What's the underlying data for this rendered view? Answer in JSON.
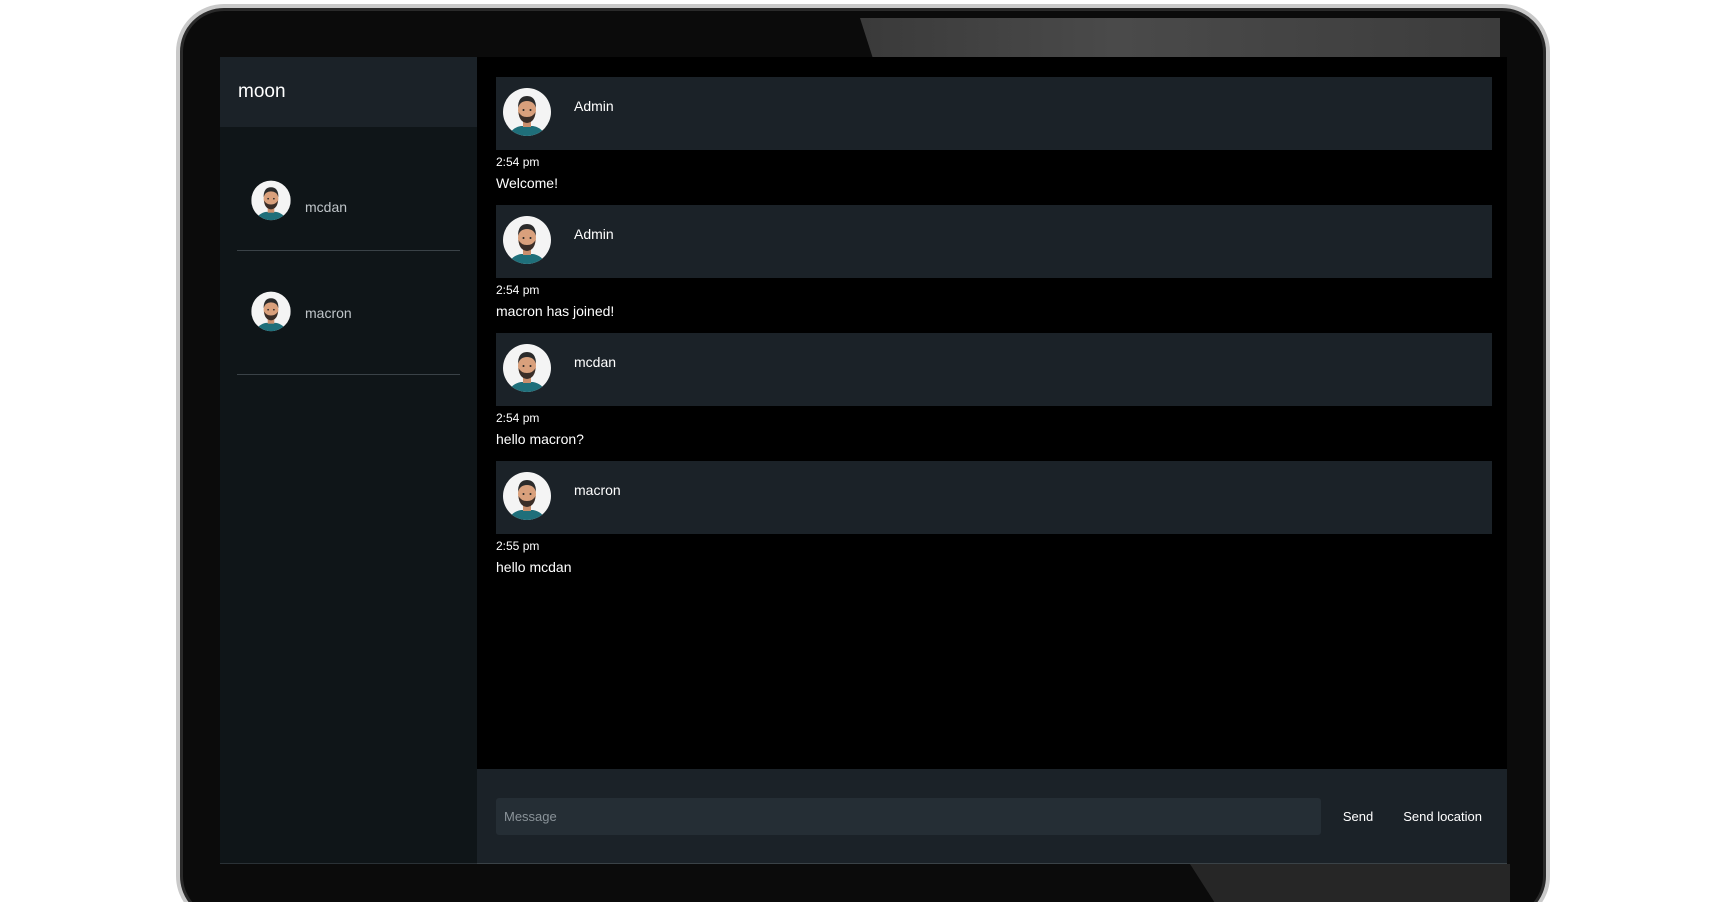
{
  "room": {
    "name": "moon"
  },
  "users": [
    {
      "name": "mcdan"
    },
    {
      "name": "macron"
    }
  ],
  "messages": [
    {
      "author": "Admin",
      "time": "2:54 pm",
      "text": "Welcome!"
    },
    {
      "author": "Admin",
      "time": "2:54 pm",
      "text": "macron has joined!"
    },
    {
      "author": "mcdan",
      "time": "2:54 pm",
      "text": "hello macron?"
    },
    {
      "author": "macron",
      "time": "2:55 pm",
      "text": "hello mcdan"
    }
  ],
  "composer": {
    "placeholder": "Message",
    "send_label": "Send",
    "location_label": "Send location"
  },
  "colors": {
    "sidebar_bg": "#0f1518",
    "panel_bg": "#1b2228",
    "input_bg": "#252e35",
    "avatar_shirt": "#1f6f7a"
  }
}
